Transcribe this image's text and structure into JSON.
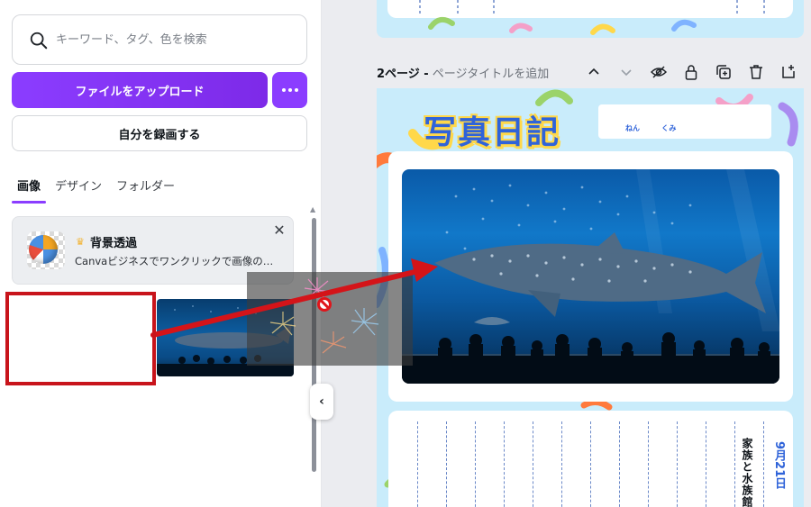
{
  "search": {
    "placeholder": "キーワード、タグ、色を検索"
  },
  "actions": {
    "upload_label": "ファイルをアップロード",
    "record_label": "自分を録画する"
  },
  "tabs": [
    {
      "label": "画像",
      "active": true
    },
    {
      "label": "デザイン",
      "active": false
    },
    {
      "label": "フォルダー",
      "active": false
    }
  ],
  "promo": {
    "title": "背景透過",
    "description": "Canvaビジネスでワンクリックで画像の…"
  },
  "page": {
    "number_label": "2ページ -",
    "title_placeholder": "ページタイトルを追加"
  },
  "toolbar_icons": [
    "chevron-up-icon",
    "chevron-down-icon",
    "eye-hide-icon",
    "lock-icon",
    "duplicate-icon",
    "trash-icon",
    "add-page-icon"
  ],
  "canvas": {
    "diary_title": "写真日記",
    "nen_label": "ねん",
    "kumi_label": "くみ",
    "entry_title": "家族と水族館",
    "entry_date": "9月21日"
  },
  "colors": {
    "accent": "#8b3dff",
    "highlight_box": "#c8141b",
    "arrow": "#d41419",
    "page_background": "#c9ecfb",
    "title_blue": "#2f63d9"
  }
}
